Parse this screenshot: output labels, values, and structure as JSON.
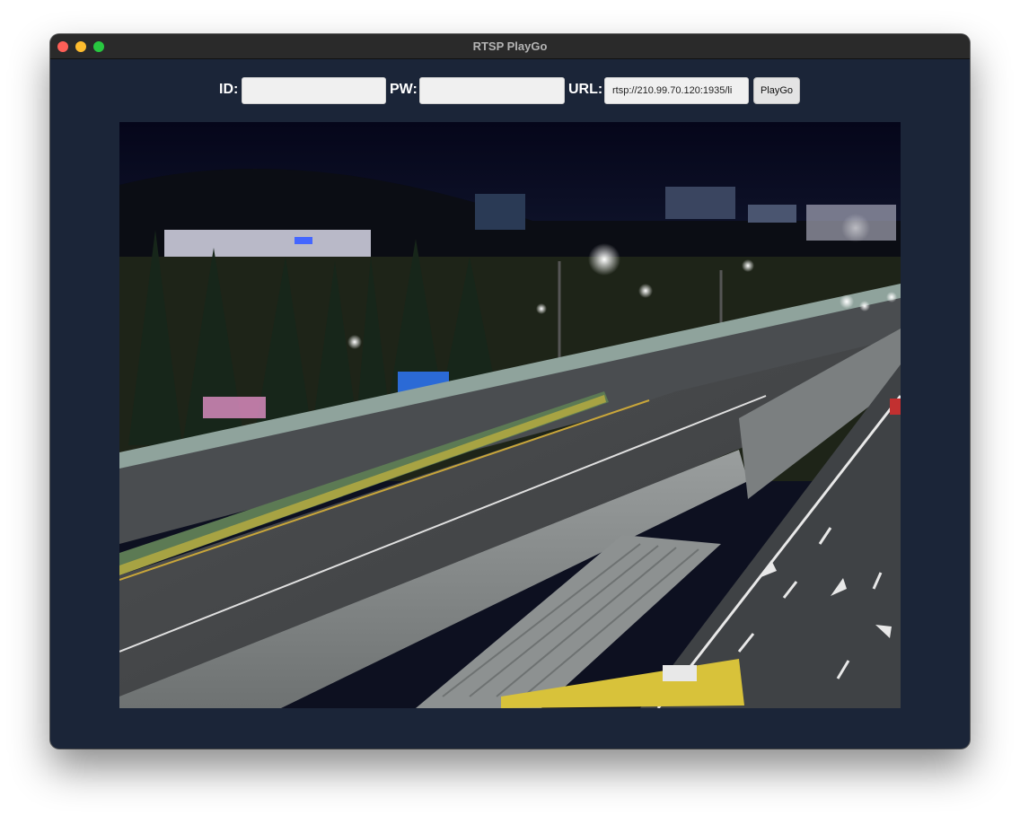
{
  "window": {
    "title": "RTSP PlayGo"
  },
  "toolbar": {
    "id_label": "ID:",
    "id_value": "",
    "pw_label": "PW:",
    "pw_value": "",
    "url_label": "URL:",
    "url_value": "rtsp://210.99.70.120:1935/li",
    "play_button": "PlayGo"
  },
  "video": {
    "description_icon": "camera-feed"
  }
}
